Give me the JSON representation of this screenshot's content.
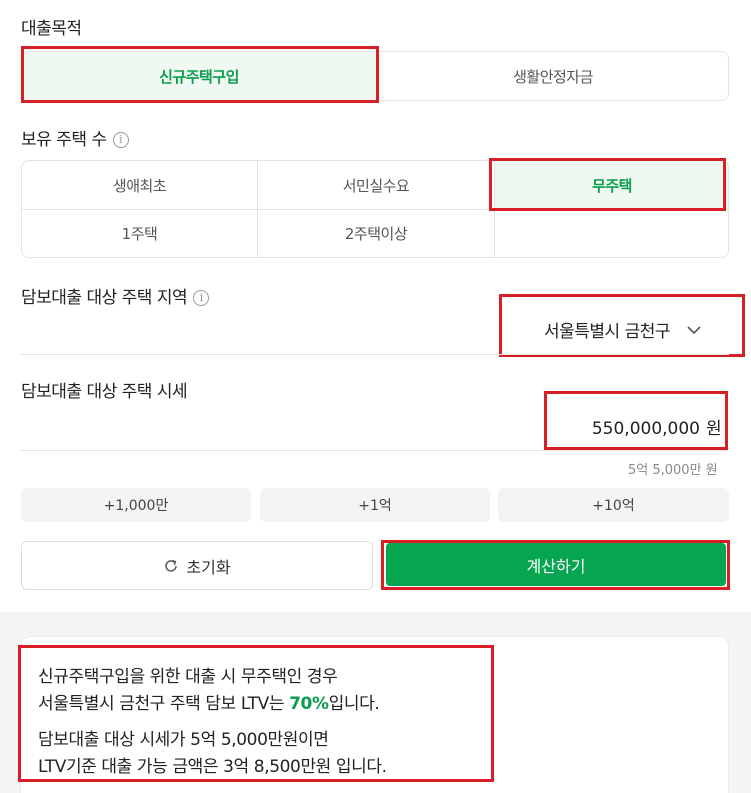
{
  "purpose": {
    "label": "대출목적",
    "options": [
      "신규주택구입",
      "생활안정자금"
    ],
    "selected": "신규주택구입"
  },
  "houses": {
    "label": "보유 주택 수",
    "info": "i",
    "options": [
      "생애최초",
      "서민실수요",
      "무주택",
      "1주택",
      "2주택이상"
    ],
    "selected": "무주택"
  },
  "region": {
    "label": "담보대출 대상 주택 지역",
    "info": "i",
    "value": "서울특별시 금천구"
  },
  "price": {
    "label": "담보대출 대상 주택 시세",
    "value": "550,000,000",
    "unit": "원",
    "helper": "5억 5,000만 원"
  },
  "quick_add": [
    "+1,000만",
    "+1억",
    "+10억"
  ],
  "buttons": {
    "reset": "초기화",
    "calculate": "계산하기"
  },
  "result": {
    "line1": "신규주택구입을 위한 대출 시 무주택인 경우",
    "line2_pre": "서울특별시 금천구 주택 담보 LTV는 ",
    "line2_ltv": "70%",
    "line2_post": "입니다.",
    "line3": "담보대출 대상 시세가 5억 5,000만원이면",
    "line4": "LTV기준 대출 가능 금액은 3억 8,500만원 입니다."
  },
  "colors": {
    "accent_green": "#06a651",
    "highlight_red": "#d91f26"
  }
}
